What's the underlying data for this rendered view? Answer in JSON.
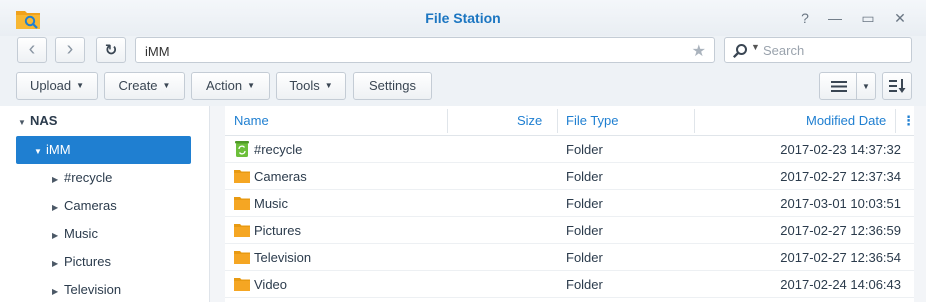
{
  "window": {
    "title": "File Station",
    "controls": {
      "help": "?",
      "minimize": "—",
      "maximize": "▭",
      "close": "✕"
    }
  },
  "navigation": {
    "back_glyph": "‹",
    "forward_glyph": "›",
    "refresh_glyph": "↻",
    "path": "iMM",
    "favorite_glyph": "★"
  },
  "search": {
    "placeholder": "Search",
    "value": ""
  },
  "toolbar": {
    "upload": "Upload",
    "create": "Create",
    "action": "Action",
    "tools": "Tools",
    "settings": "Settings",
    "caret": "▼"
  },
  "tree": {
    "root": "NAS",
    "selected": "iMM",
    "children": [
      "#recycle",
      "Cameras",
      "Music",
      "Pictures",
      "Television"
    ],
    "arrow_open": "▼",
    "arrow_closed": "▶"
  },
  "grid": {
    "columns": {
      "name": "Name",
      "size": "Size",
      "type": "File Type",
      "modified": "Modified Date",
      "menu": "⋮"
    },
    "rows": [
      {
        "name": "#recycle",
        "size": "",
        "type": "Folder",
        "modified": "2017-02-23 14:37:32",
        "icon": "recycle-bin-icon"
      },
      {
        "name": "Cameras",
        "size": "",
        "type": "Folder",
        "modified": "2017-02-27 12:37:34",
        "icon": "folder-icon"
      },
      {
        "name": "Music",
        "size": "",
        "type": "Folder",
        "modified": "2017-03-01 10:03:51",
        "icon": "folder-icon"
      },
      {
        "name": "Pictures",
        "size": "",
        "type": "Folder",
        "modified": "2017-02-27 12:36:59",
        "icon": "folder-icon"
      },
      {
        "name": "Television",
        "size": "",
        "type": "Folder",
        "modified": "2017-02-27 12:36:54",
        "icon": "folder-icon"
      },
      {
        "name": "Video",
        "size": "",
        "type": "Folder",
        "modified": "2017-02-24 14:06:43",
        "icon": "folder-icon"
      }
    ]
  },
  "colors": {
    "accent": "#1f7fd1",
    "folder": "#f5a623",
    "recycle": "#6cbf3a",
    "title": "#1c76c1"
  }
}
